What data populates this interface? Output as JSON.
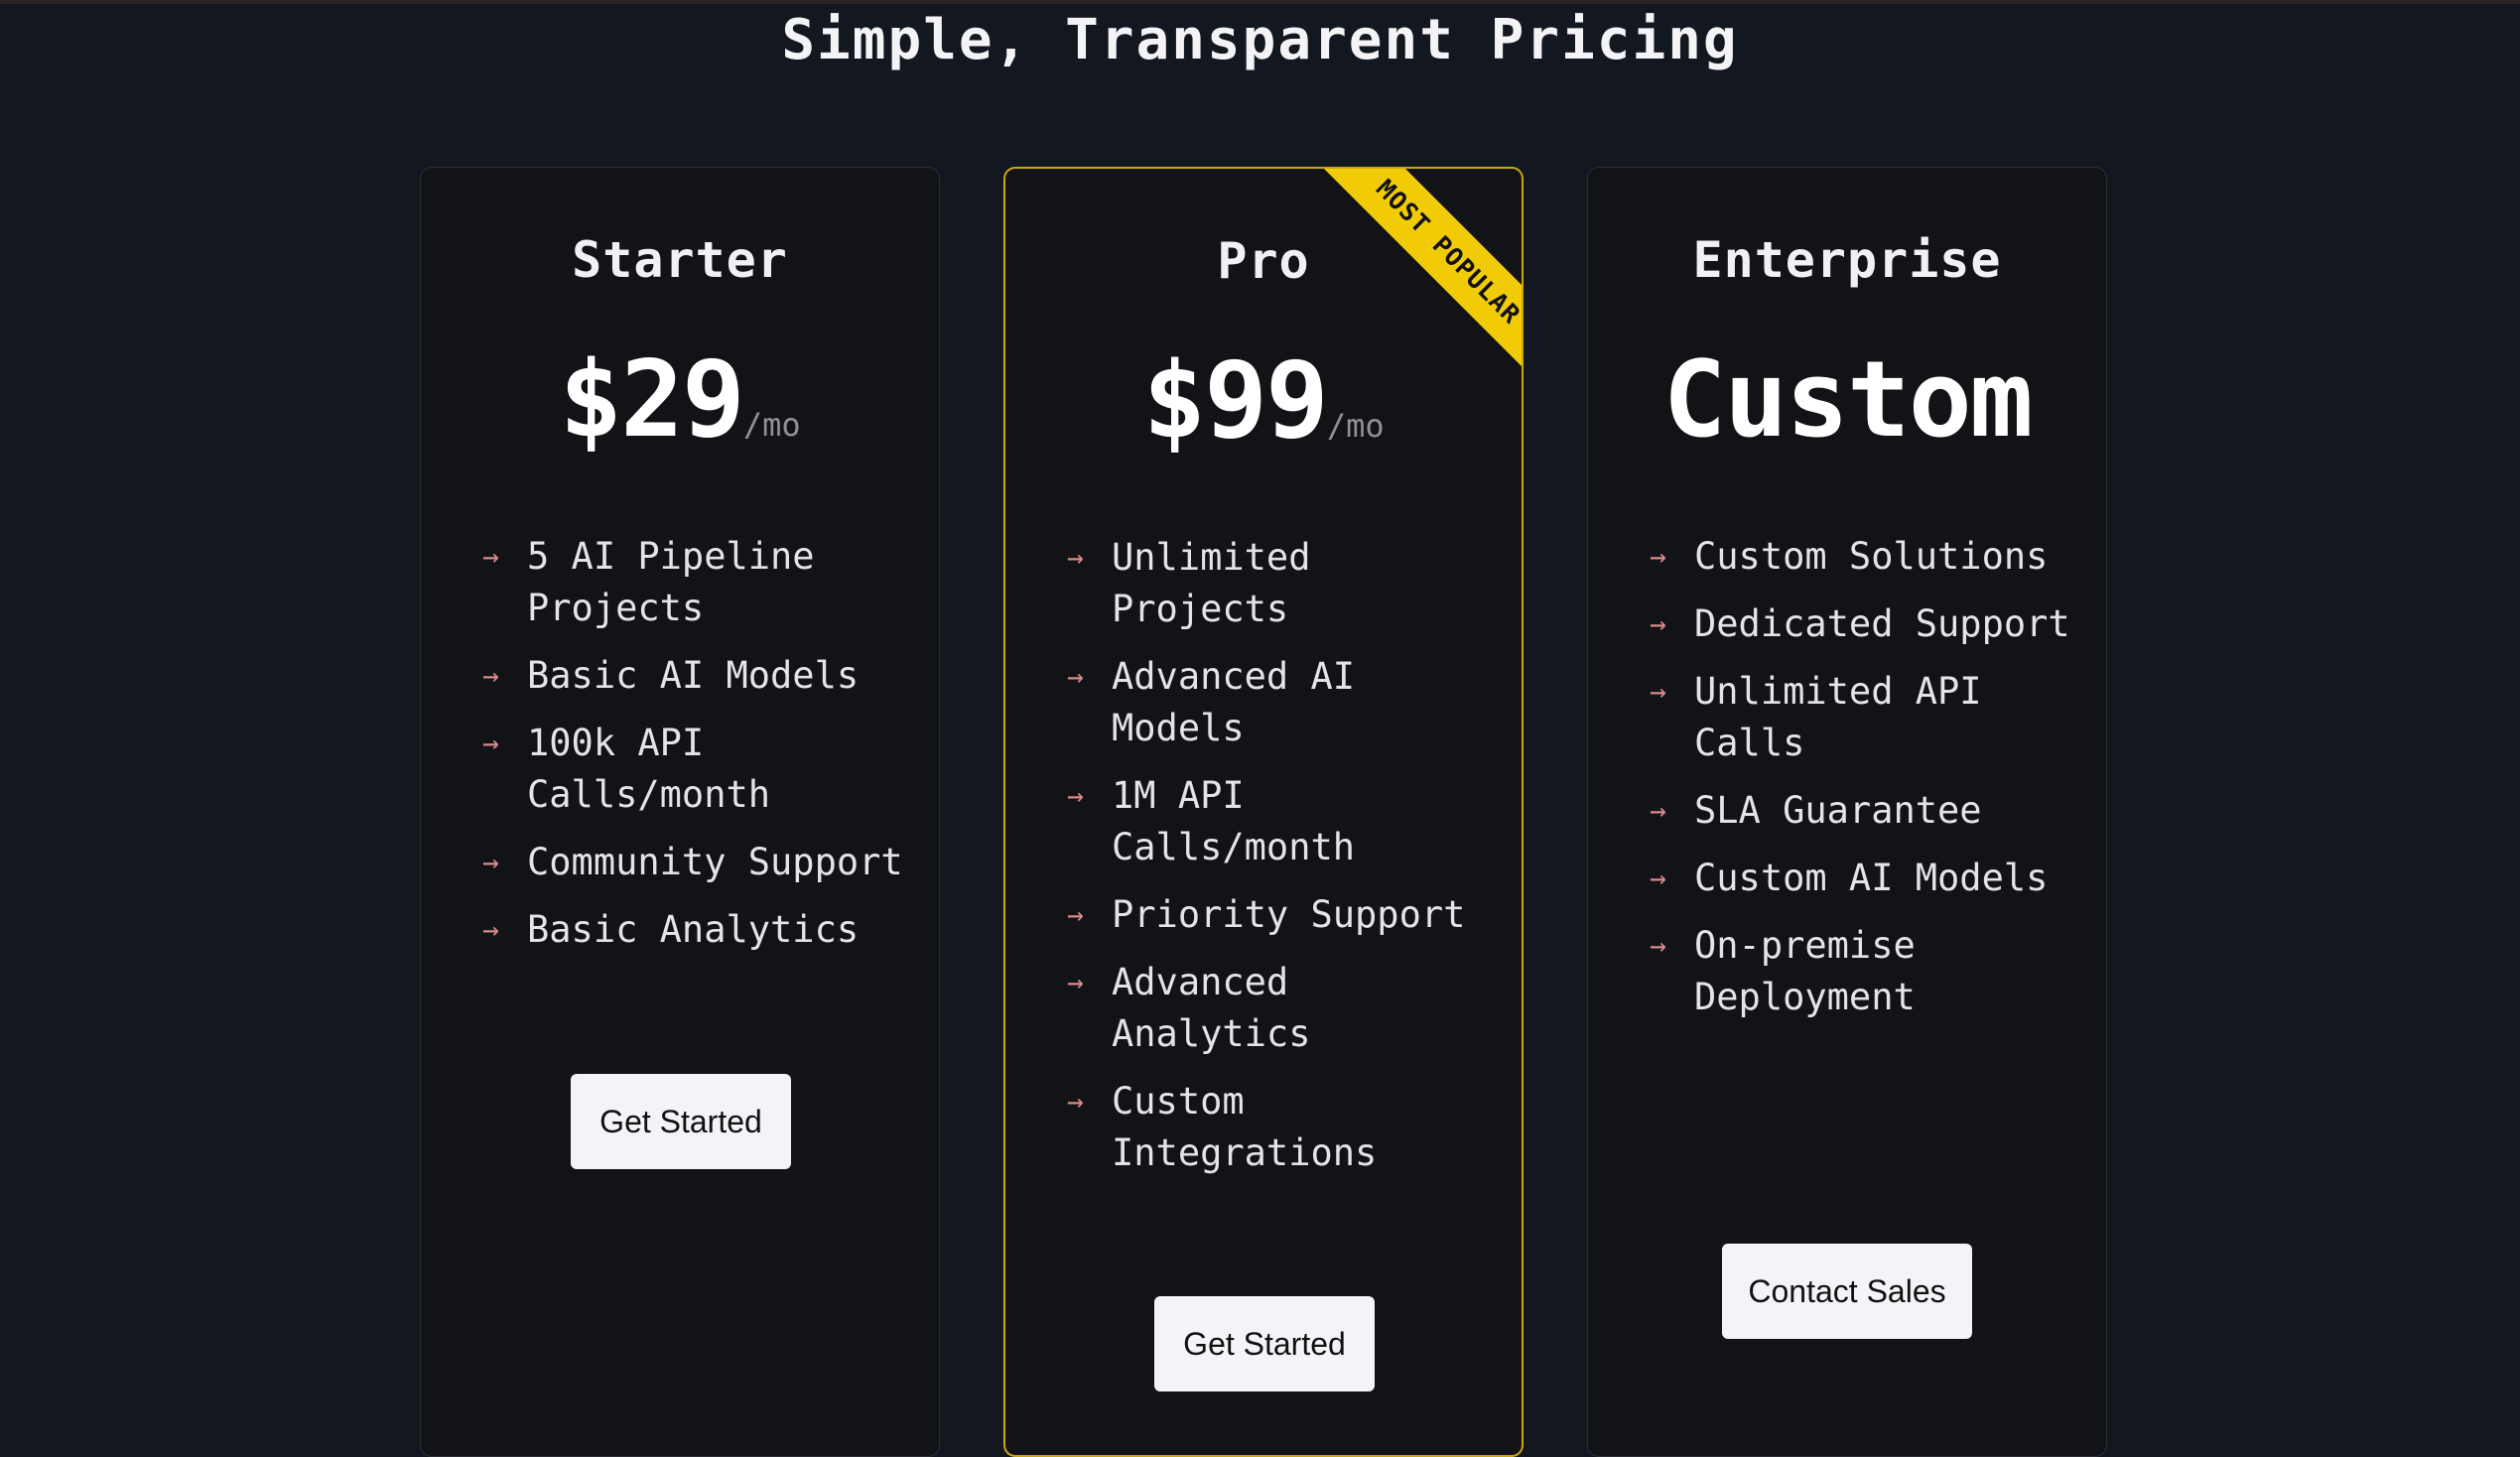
{
  "page": {
    "title": "Simple, Transparent Pricing"
  },
  "plans": [
    {
      "name": "Starter",
      "price": "$29",
      "period": "/mo",
      "features": [
        "5 AI Pipeline Projects",
        "Basic AI Models",
        "100k API Calls/month",
        "Community Support",
        "Basic Analytics"
      ],
      "button": "Get Started"
    },
    {
      "name": "Pro",
      "price": "$99",
      "period": "/mo",
      "badge": "MOST POPULAR",
      "features": [
        "Unlimited Projects",
        "Advanced AI Models",
        "1M API Calls/month",
        "Priority Support",
        "Advanced Analytics",
        "Custom Integrations"
      ],
      "button": "Get Started"
    },
    {
      "name": "Enterprise",
      "price": "Custom",
      "features": [
        "Custom Solutions",
        "Dedicated Support",
        "Unlimited API Calls",
        "SLA Guarantee",
        "Custom AI Models",
        "On-premise Deployment"
      ],
      "button": "Contact Sales"
    }
  ],
  "icons": {
    "feature_bullet": "arrow-right-icon"
  },
  "colors": {
    "background": "#131720",
    "card": "#121317",
    "featured_border": "#c9a80c",
    "badge": "#f2cb07",
    "arrow": "#d98a8a",
    "button": "#f3f4f7"
  }
}
